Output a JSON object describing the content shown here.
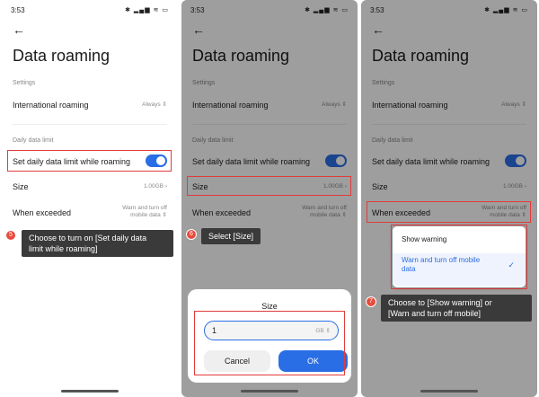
{
  "status": {
    "time": "3:53",
    "icons": "✱ ▂▄▆ ≋ ▭"
  },
  "screen": {
    "title": "Data roaming",
    "settings_section": "Settings",
    "international_roaming": {
      "label": "International roaming",
      "value": "Always"
    },
    "daily_section": "Daily data limit",
    "set_limit": {
      "label": "Set daily data limit while roaming",
      "on": true
    },
    "size": {
      "label": "Size",
      "value": "1.00GB"
    },
    "when_exceeded": {
      "label": "When exceeded",
      "value_line1": "Warn and turn off",
      "value_line2": "mobile data"
    }
  },
  "steps": [
    {
      "number": "5",
      "text_line1": "Choose to turn on [Set daily data",
      "text_line2": "limit while roaming]"
    },
    {
      "number": "6",
      "text_line1": "Select [Size]"
    },
    {
      "number": "7",
      "text_line1": "Choose to [Show warning] or",
      "text_line2": "[Warn and turn off mobile]"
    }
  ],
  "size_dialog": {
    "title": "Size",
    "input_value": "1",
    "unit": "GB",
    "cancel_label": "Cancel",
    "ok_label": "OK"
  },
  "exceeded_dropdown": {
    "options": [
      {
        "label": "Show warning",
        "selected": false
      },
      {
        "label_line1": "Warn and turn off mobile",
        "label_line2": "data",
        "selected": true
      }
    ]
  },
  "colors": {
    "accent": "#2a6ee5",
    "highlight": "#e23b3b",
    "badge": "#e84c3d",
    "callout": "#3a3a3a"
  }
}
